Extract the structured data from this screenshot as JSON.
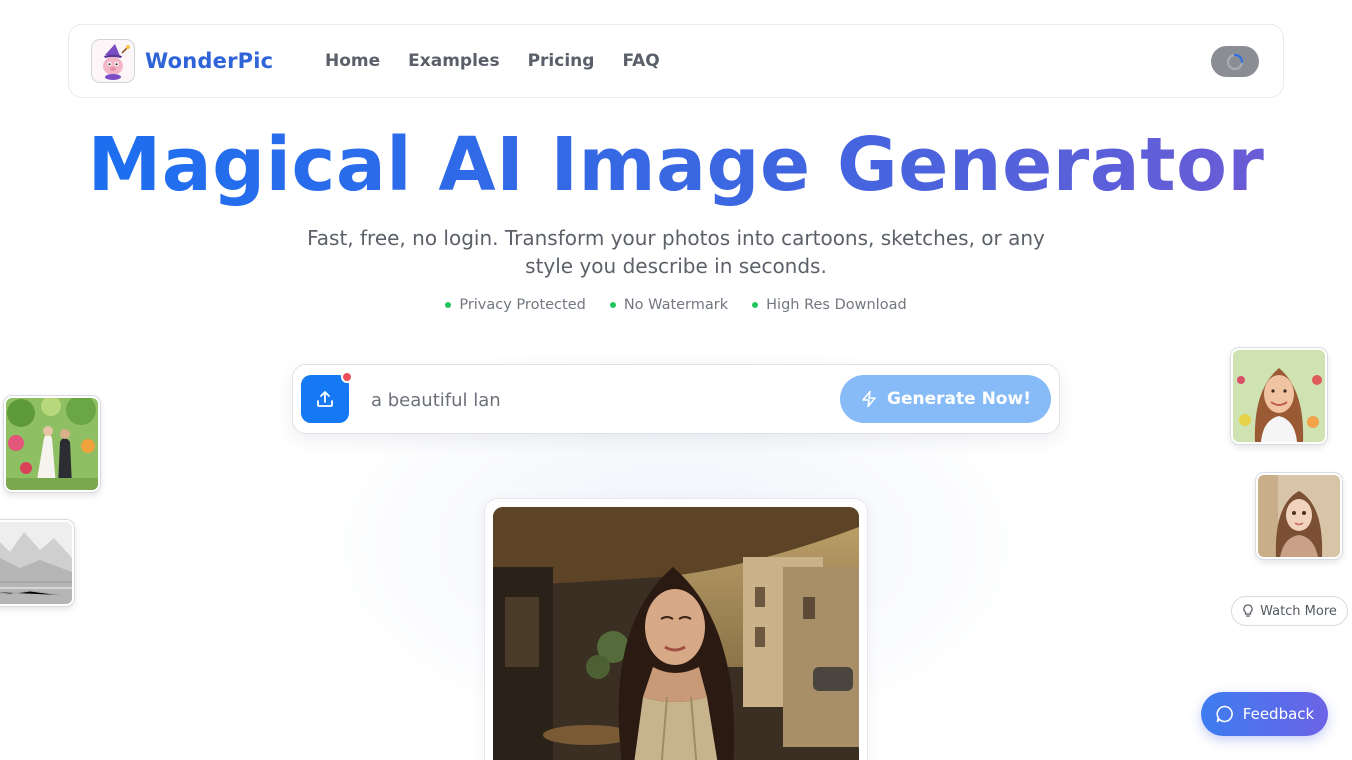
{
  "header": {
    "brand": "WonderPic",
    "nav": [
      "Home",
      "Examples",
      "Pricing",
      "FAQ"
    ]
  },
  "hero": {
    "title": "Magical AI Image Generator",
    "subtitle": "Fast, free, no login. Transform your photos into cartoons, sketches, or any style you describe in seconds.",
    "features": [
      "Privacy Protected",
      "No Watermark",
      "High Res Download"
    ]
  },
  "prompt": {
    "value": "a beautiful lan",
    "generate_label": "Generate Now!"
  },
  "watch_more_label": "Watch More",
  "feedback_label": "Feedback",
  "colors": {
    "accent": "#1479f2",
    "generate_button": "#86bbf7",
    "feature_dot": "#22c55e",
    "notification_dot": "#ef4f5a"
  },
  "icons": {
    "upload": "upload-icon",
    "generate": "lightning-icon",
    "watch_more": "lightbulb-icon",
    "feedback": "chat-bubble-icon",
    "user": "loading-spinner-icon"
  }
}
